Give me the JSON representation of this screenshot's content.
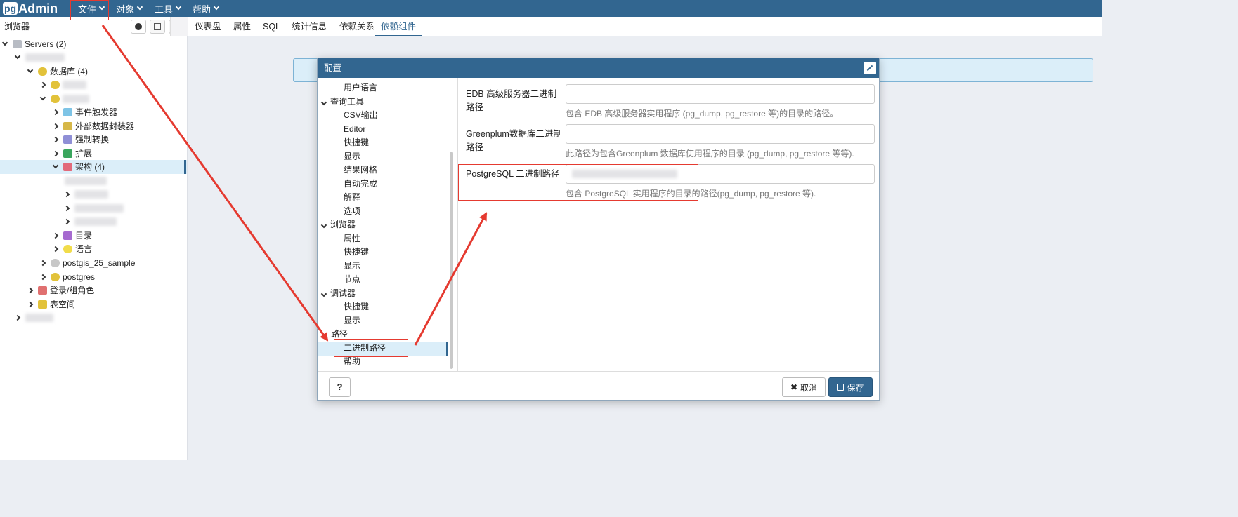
{
  "app": {
    "logo_pg": "pg",
    "logo_rest": "Admin"
  },
  "menu": [
    {
      "label": "文件"
    },
    {
      "label": "对象"
    },
    {
      "label": "工具"
    },
    {
      "label": "帮助"
    }
  ],
  "browser": {
    "title": "浏览器",
    "tree": [
      {
        "label": "Servers (2)"
      },
      {
        "label": ""
      },
      {
        "label": "数据库 (4)"
      },
      {
        "label": ""
      },
      {
        "label": ""
      },
      {
        "label": "事件触发器"
      },
      {
        "label": "外部数据封装器"
      },
      {
        "label": "强制转换"
      },
      {
        "label": "扩展"
      },
      {
        "label": "架构 (4)"
      },
      {
        "label": ""
      },
      {
        "label": ""
      },
      {
        "label": ""
      },
      {
        "label": ""
      },
      {
        "label": "目录"
      },
      {
        "label": "语言"
      },
      {
        "label": "postgis_25_sample"
      },
      {
        "label": "postgres"
      },
      {
        "label": "登录/组角色"
      },
      {
        "label": "表空间"
      },
      {
        "label": ""
      }
    ]
  },
  "tabs": [
    "仪表盘",
    "属性",
    "SQL",
    "统计信息",
    "依赖关系",
    "依赖组件"
  ],
  "dialog": {
    "title": "配置",
    "nav": [
      {
        "label": "用户语言"
      },
      {
        "label": "查询工具"
      },
      {
        "label": "CSV输出"
      },
      {
        "label": "Editor"
      },
      {
        "label": "快捷键"
      },
      {
        "label": "显示"
      },
      {
        "label": "结果网格"
      },
      {
        "label": "自动完成"
      },
      {
        "label": "解释"
      },
      {
        "label": "选项"
      },
      {
        "label": "浏览器"
      },
      {
        "label": "属性"
      },
      {
        "label": "快捷键"
      },
      {
        "label": "显示"
      },
      {
        "label": "节点"
      },
      {
        "label": "调试器"
      },
      {
        "label": "快捷键"
      },
      {
        "label": "显示"
      },
      {
        "label": "路径"
      },
      {
        "label": "二进制路径"
      },
      {
        "label": "帮助"
      }
    ],
    "fields": [
      {
        "label": "EDB 高级服务器二进制路径",
        "value": "",
        "help": "包含 EDB 高级服务器实用程序 (pg_dump, pg_restore 等)的目录的路径。"
      },
      {
        "label": "Greenplum数据库二进制路径",
        "value": "",
        "help": "此路径为包含Greenplum 数据库使用程序的目录 (pg_dump, pg_restore 等等)."
      },
      {
        "label": "PostgreSQL 二进制路径",
        "value": "",
        "help": "包含 PostgreSQL 实用程序的目录的路径(pg_dump, pg_restore 等)."
      }
    ],
    "help_button": "?",
    "cancel_button": "取消",
    "save_button": "保存"
  },
  "colors": {
    "topbar": "#326690",
    "accent": "#326690",
    "selection": "#dbeef9",
    "annotation": "#e53a30"
  }
}
